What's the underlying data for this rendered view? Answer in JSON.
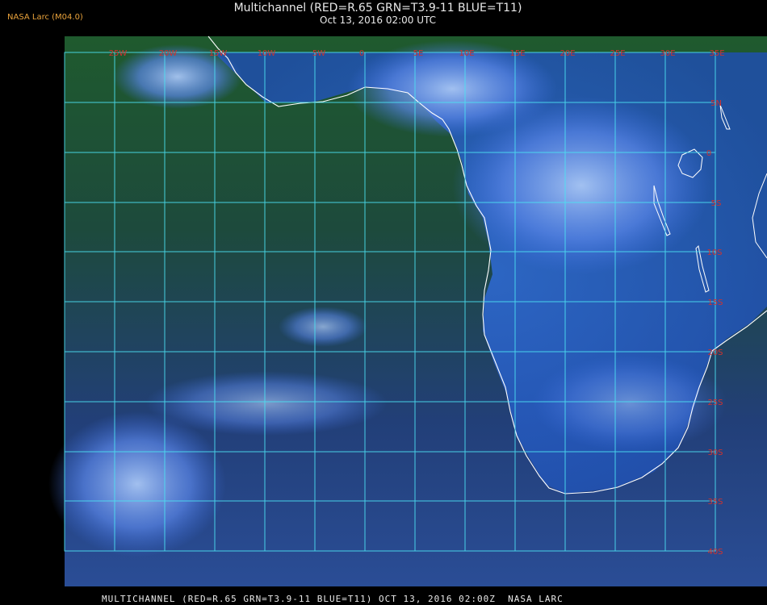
{
  "header": {
    "org_label": "NASA Larc (M04.0)",
    "title": "Multichannel (RED=R.65 GRN=T3.9-11 BLUE=T11)",
    "subtitle": "Oct 13, 2016 02:00 UTC"
  },
  "footer": {
    "caption": "MULTICHANNEL (RED=R.65 GRN=T3.9-11 BLUE=T11) OCT 13, 2016 02:00Z  NASA LARC"
  },
  "map": {
    "colors": {
      "background": "#000000",
      "ocean_green": "#1d4a2a",
      "ocean_blue": "#234a86",
      "cloud_blue": "#3d6ee0",
      "cloud_bright": "#8fb5f0",
      "gridline": "#4ce0f2",
      "coastline": "#ffffff",
      "label": "#d2322d"
    },
    "lon_labels": [
      "25W",
      "20W",
      "15W",
      "10W",
      "5W",
      "0",
      "5E",
      "10E",
      "15E",
      "20E",
      "25E",
      "30E",
      "35E"
    ],
    "lat_labels": [
      "5N",
      "0",
      "5S",
      "10S",
      "15S",
      "20S",
      "25S",
      "30S",
      "35S",
      "40S"
    ]
  }
}
